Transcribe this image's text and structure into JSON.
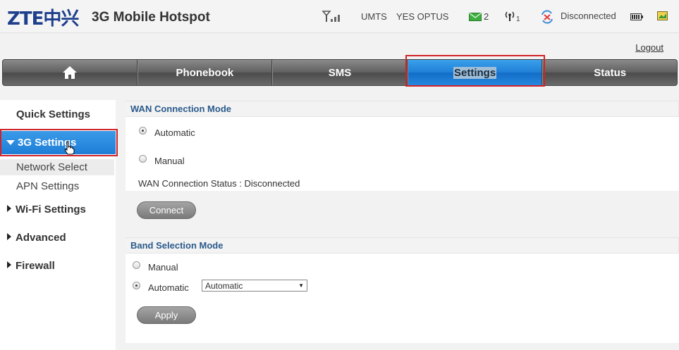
{
  "header": {
    "logo": "ZTE中兴",
    "title": "3G Mobile Hotspot",
    "network_type": "UMTS",
    "operator": "YES OPTUS",
    "sms_count": "2",
    "wifi_clients": "1",
    "connection_status": "Disconnected",
    "icons": [
      "signal-icon",
      "envelope-icon",
      "wifi-antenna-icon",
      "disconnected-icon",
      "battery-icon",
      "sim-icon"
    ]
  },
  "logout": "Logout",
  "nav": {
    "home_icon": "home-icon",
    "phonebook": "Phonebook",
    "sms": "SMS",
    "settings": "Settings",
    "status": "Status"
  },
  "sidebar": {
    "quick_settings": "Quick Settings",
    "g3_settings": "3G Settings",
    "network_select": "Network Select",
    "apn_settings": "APN Settings",
    "wifi_settings": "Wi-Fi Settings",
    "advanced": "Advanced",
    "firewall": "Firewall"
  },
  "wan": {
    "heading": "WAN Connection Mode",
    "automatic": "Automatic",
    "manual": "Manual",
    "selected": "Automatic",
    "status_text": "WAN Connection Status : Disconnected",
    "connect_button": "Connect"
  },
  "band": {
    "heading": "Band Selection Mode",
    "manual": "Manual",
    "automatic": "Automatic",
    "selected": "Automatic",
    "select_value": "Automatic",
    "apply_button": "Apply"
  },
  "colors": {
    "accent_blue": "#1f7fd6",
    "highlight_red": "#d1222a",
    "heading_blue": "#2a5a8c"
  }
}
